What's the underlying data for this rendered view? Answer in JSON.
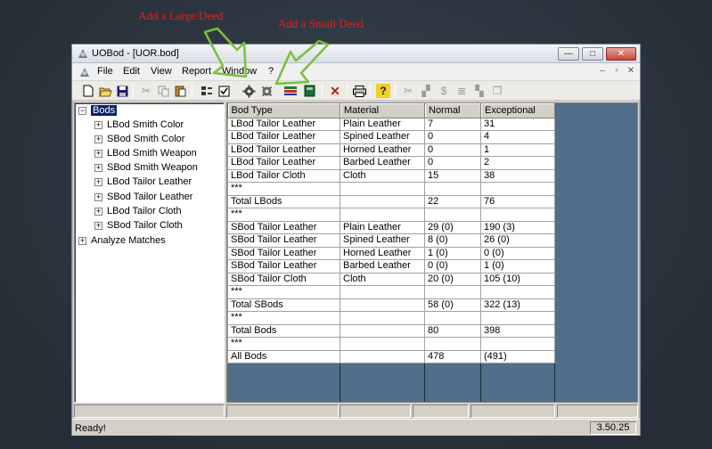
{
  "annotations": {
    "large_deed": "Add a Large Deed",
    "small_deed": "Add a Small Deed"
  },
  "window": {
    "title": "UOBod - [UOR.bod]",
    "buttons": {
      "minimize": "—",
      "maximize": "□",
      "close": "✕"
    }
  },
  "menu": {
    "items": [
      "File",
      "Edit",
      "View",
      "Report",
      "Window",
      "?"
    ],
    "mdi_buttons": [
      "–",
      "▫",
      "✕"
    ]
  },
  "toolbar": {
    "icons": [
      "new-icon",
      "open-icon",
      "save-icon",
      "cut-icon",
      "copy-icon",
      "paste-icon",
      "add-large-deed-icon",
      "add-small-deed-icon",
      "gear-icon",
      "gear-alt-icon",
      "filter-icon",
      "book-icon",
      "delete-icon",
      "print-icon",
      "help-icon"
    ]
  },
  "tree": {
    "root": "Bods",
    "children": [
      "LBod Smith Color",
      "SBod Smith Color",
      "LBod Smith Weapon",
      "SBod Smith Weapon",
      "LBod Tailor Leather",
      "SBod Tailor Leather",
      "LBod Tailor Cloth",
      "SBod Tailor Cloth"
    ],
    "analyze": "Analyze Matches"
  },
  "grid": {
    "columns": [
      "Bod Type",
      "Material",
      "Normal",
      "Exceptional"
    ],
    "rows": [
      [
        "LBod Tailor Leather",
        "Plain Leather",
        "7",
        "31"
      ],
      [
        "LBod Tailor Leather",
        "Spined Leather",
        "0",
        "4"
      ],
      [
        "LBod Tailor Leather",
        "Horned Leather",
        "0",
        "1"
      ],
      [
        "LBod Tailor Leather",
        "Barbed Leather",
        "0",
        "2"
      ],
      [
        "LBod Tailor Cloth",
        "Cloth",
        "15",
        "38"
      ],
      [
        "***",
        "",
        "",
        ""
      ],
      [
        "Total LBods",
        "",
        "22",
        "76"
      ],
      [
        "***",
        "",
        "",
        ""
      ],
      [
        "SBod Tailor Leather",
        "Plain Leather",
        "29 (0)",
        "190 (3)"
      ],
      [
        "SBod Tailor Leather",
        "Spined Leather",
        "8 (0)",
        "26 (0)"
      ],
      [
        "SBod Tailor Leather",
        "Horned Leather",
        "1 (0)",
        "0 (0)"
      ],
      [
        "SBod Tailor Leather",
        "Barbed Leather",
        "0 (0)",
        "1 (0)"
      ],
      [
        "SBod Tailor Cloth",
        "Cloth",
        "20 (0)",
        "105 (10)"
      ],
      [
        "***",
        "",
        "",
        ""
      ],
      [
        "Total SBods",
        "",
        "58 (0)",
        "322 (13)"
      ],
      [
        "***",
        "",
        "",
        ""
      ],
      [
        "Total Bods",
        "",
        "80",
        "398"
      ],
      [
        "***",
        "",
        "",
        ""
      ],
      [
        "All Bods",
        "",
        "478",
        "(491)"
      ]
    ]
  },
  "status": {
    "text": "Ready!",
    "version": "3.50.25"
  }
}
